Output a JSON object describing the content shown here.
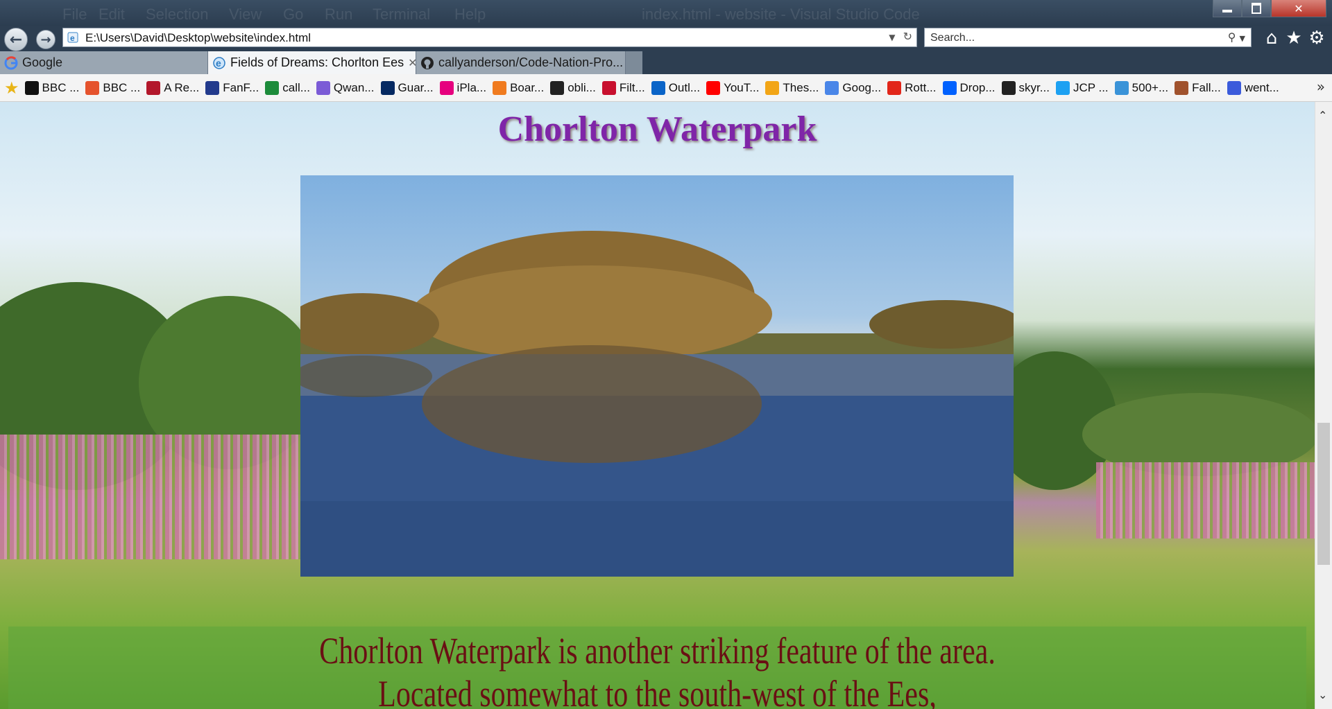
{
  "browser": {
    "background_title_ghost": [
      "File",
      "Edit",
      "Selection",
      "View",
      "Go",
      "Run",
      "Terminal",
      "Help",
      "index.html - website - Visual Studio Code"
    ],
    "address": {
      "url": "E:\\Users\\David\\Desktop\\website\\index.html"
    },
    "search": {
      "placeholder": "Search..."
    },
    "tabs": [
      {
        "label": "Google",
        "active": false,
        "icon": "google-icon"
      },
      {
        "label": "Fields of Dreams: Chorlton Ees",
        "active": true,
        "icon": "ie-page-icon"
      },
      {
        "label": "callyanderson/Code-Nation-Pro...",
        "active": false,
        "icon": "github-icon"
      }
    ],
    "favorites": [
      {
        "label": "BBC ...",
        "icon": "bbc-icon",
        "color": "#111111"
      },
      {
        "label": "BBC ...",
        "icon": "s-icon",
        "color": "#e5532d"
      },
      {
        "label": "A Re...",
        "icon": "t-icon",
        "color": "#b3172b"
      },
      {
        "label": "FanF...",
        "icon": "fanfic-icon",
        "color": "#223a8c"
      },
      {
        "label": "call...",
        "icon": "z-icon",
        "color": "#1c8b3a"
      },
      {
        "label": "Qwan...",
        "icon": "qwant-icon",
        "color": "#7b5bd6"
      },
      {
        "label": "Guar...",
        "icon": "guardian-icon",
        "color": "#052962"
      },
      {
        "label": "iPla...",
        "icon": "iplayer-icon",
        "color": "#e6007e"
      },
      {
        "label": "Boar...",
        "icon": "board-icon",
        "color": "#f07b1f"
      },
      {
        "label": "obli...",
        "icon": "obli-icon",
        "color": "#222222"
      },
      {
        "label": "Filt...",
        "icon": "fb-icon",
        "color": "#c8102e"
      },
      {
        "label": "Outl...",
        "icon": "outlook-icon",
        "color": "#0a64c8"
      },
      {
        "label": "YouT...",
        "icon": "youtube-icon",
        "color": "#ff0000"
      },
      {
        "label": "Thes...",
        "icon": "thesaurus-icon",
        "color": "#f2a516"
      },
      {
        "label": "Goog...",
        "icon": "translate-icon",
        "color": "#4a86e8"
      },
      {
        "label": "Rott...",
        "icon": "tomato-icon",
        "color": "#e2261a"
      },
      {
        "label": "Drop...",
        "icon": "dropbox-icon",
        "color": "#0061fe"
      },
      {
        "label": "skyr...",
        "icon": "skyrim-icon",
        "color": "#222222"
      },
      {
        "label": "JCP ...",
        "icon": "twitter-icon",
        "color": "#1da1f2"
      },
      {
        "label": "500+...",
        "icon": "ie-page-icon",
        "color": "#3a93d8"
      },
      {
        "label": "Fall...",
        "icon": "fallout-icon",
        "color": "#a0522d"
      },
      {
        "label": "went...",
        "icon": "went-icon",
        "color": "#3b5bdb"
      }
    ]
  },
  "page": {
    "title": "Chorlton Waterpark",
    "description_lines": [
      "Chorlton Waterpark is another striking feature of the area.",
      "Located somewhat to the south-west of the Ees,"
    ]
  }
}
